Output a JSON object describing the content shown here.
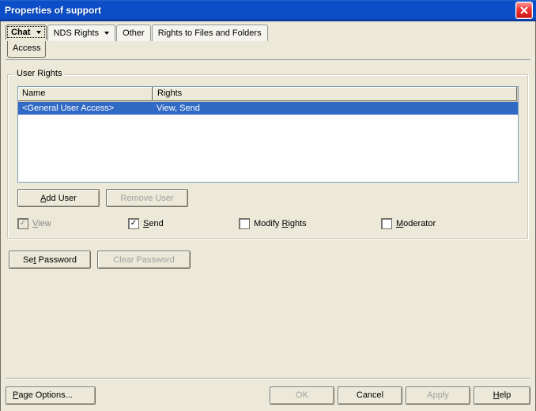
{
  "window": {
    "title": "Properties of support"
  },
  "tabs": {
    "main": "Chat",
    "main_sub": "Access",
    "t2": "NDS Rights",
    "t3": "Other",
    "t4": "Rights to Files and Folders"
  },
  "group": {
    "title": "User Rights",
    "columns": {
      "name": "Name",
      "rights": "Rights"
    },
    "rows": [
      {
        "name": "<General User Access>",
        "rights": "View, Send"
      }
    ],
    "buttons": {
      "add_user_pre": "A",
      "add_user_post": "dd User",
      "remove_user": "Remove User"
    },
    "checks": {
      "view_pre": "V",
      "view_post": "iew",
      "view_checked": true,
      "view_disabled": true,
      "send_pre": "S",
      "send_post": "end",
      "send_checked": true,
      "modify_pre": "Modify ",
      "modify_u": "R",
      "modify_post": "ights",
      "modify_checked": false,
      "mod_u": "M",
      "mod_post": "oderator",
      "mod_checked": false
    }
  },
  "password": {
    "set_pre": "Se",
    "set_u": "t",
    "set_post": " Password",
    "clear": "Clear Password"
  },
  "footer": {
    "page_u": "P",
    "page_post": "age Options...",
    "ok": "OK",
    "cancel": "Cancel",
    "apply": "Apply",
    "help_u": "H",
    "help_post": "elp"
  }
}
